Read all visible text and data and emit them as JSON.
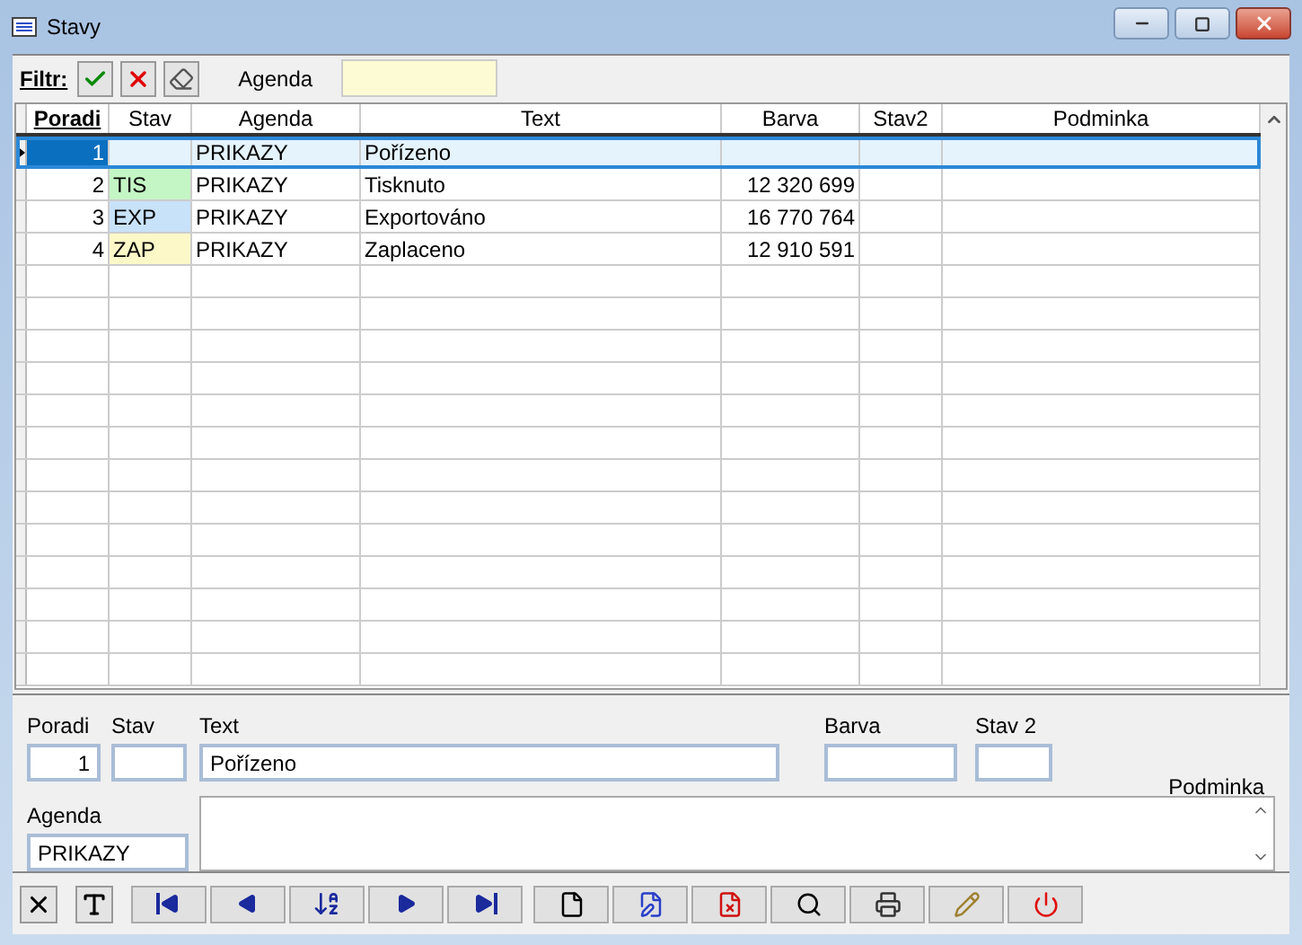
{
  "window": {
    "title": "Stavy"
  },
  "filter": {
    "label": "Filtr:",
    "agenda_label": "Agenda"
  },
  "table": {
    "columns": [
      {
        "label": "Poradi",
        "sorted": true
      },
      {
        "label": "Stav",
        "sorted": false
      },
      {
        "label": "Agenda",
        "sorted": false
      },
      {
        "label": "Text",
        "sorted": false
      },
      {
        "label": "Barva",
        "sorted": false
      },
      {
        "label": "Stav2",
        "sorted": false
      },
      {
        "label": "Podminka",
        "sorted": false
      }
    ],
    "rows": [
      {
        "poradi": "1",
        "agenda": "PRIKAZY",
        "text": "Pořízeno",
        "selected": true
      },
      {
        "poradi": "2",
        "stav": "TIS",
        "color": "#c4f5c4",
        "agenda": "PRIKAZY",
        "text": "Tisknuto",
        "barva": "12 320 699",
        "selected": false
      },
      {
        "poradi": "3",
        "stav": "EXP",
        "color": "#c8e2fa",
        "agenda": "PRIKAZY",
        "text": "Exportováno",
        "barva": "16 770 764",
        "selected": false
      },
      {
        "poradi": "4",
        "stav": "ZAP",
        "color": "#fdf8c8",
        "agenda": "PRIKAZY",
        "text": "Zaplaceno",
        "barva": "12 910 591",
        "selected": false
      }
    ]
  },
  "detail": {
    "poradi_label": "Poradi",
    "poradi": "1",
    "stav_label": "Stav",
    "text_label": "Text",
    "text": "Pořízeno",
    "barva_label": "Barva",
    "stav2_label": "Stav 2",
    "podminka_label": "Podminka",
    "agenda_label": "Agenda",
    "agenda": "PRIKAZY"
  }
}
